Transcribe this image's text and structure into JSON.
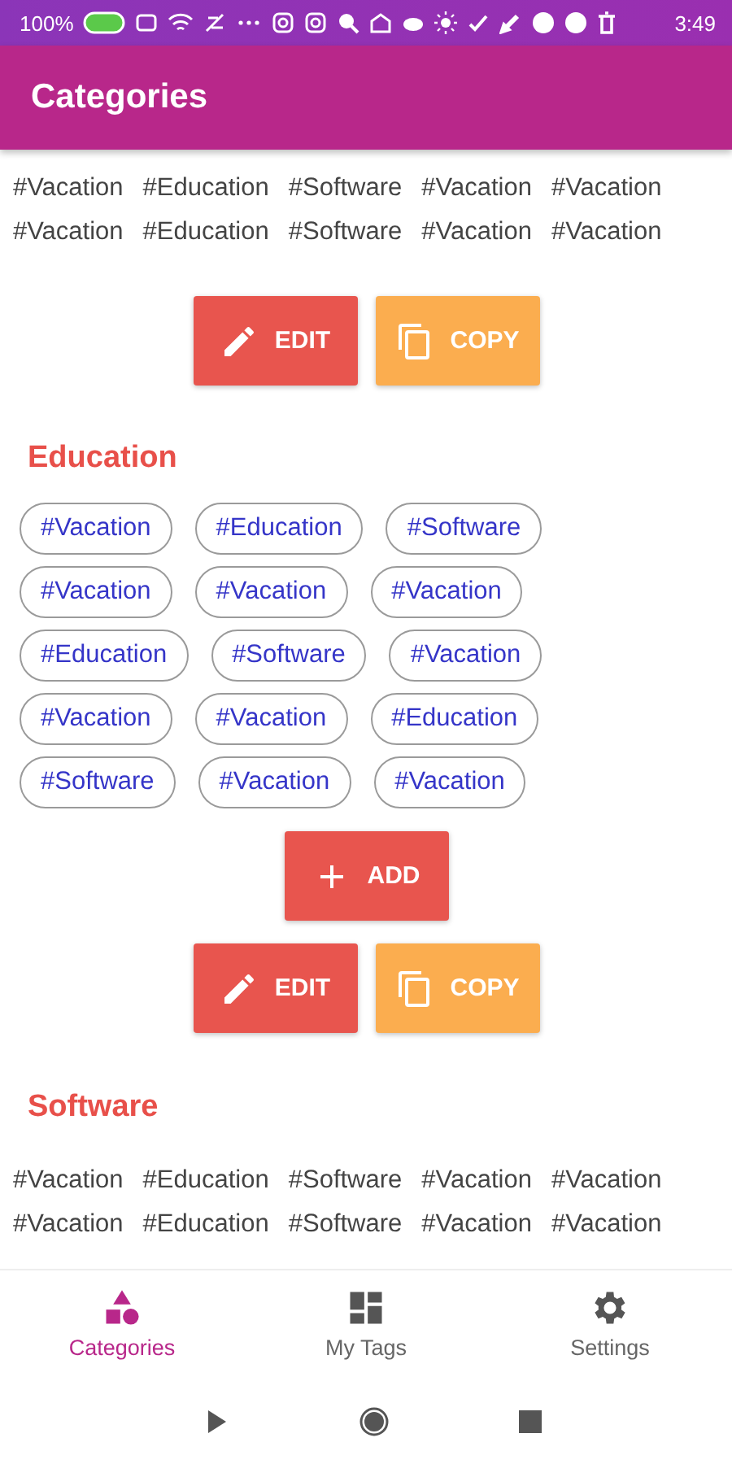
{
  "status_bar": {
    "battery": "100%",
    "time": "3:49"
  },
  "app_bar": {
    "title": "Categories"
  },
  "sections": [
    {
      "kind": "list",
      "tags": [
        "#Vacation",
        "#Education",
        "#Software",
        "#Vacation",
        "#Vacation",
        "#Vacation",
        "#Education",
        "#Software",
        "#Vacation",
        "#Vacation"
      ],
      "buttons": [
        {
          "kind": "edit",
          "label": "EDIT"
        },
        {
          "kind": "copy",
          "label": "COPY"
        }
      ]
    },
    {
      "kind": "chips",
      "title": "Education",
      "tags": [
        "#Vacation",
        "#Education",
        "#Software",
        "#Vacation",
        "#Vacation",
        "#Vacation",
        "#Education",
        "#Software",
        "#Vacation",
        "#Vacation",
        "#Vacation",
        "#Education",
        "#Software",
        "#Vacation",
        "#Vacation"
      ],
      "add": {
        "kind": "add",
        "label": "ADD"
      },
      "buttons": [
        {
          "kind": "edit",
          "label": "EDIT"
        },
        {
          "kind": "copy",
          "label": "COPY"
        }
      ]
    },
    {
      "kind": "list",
      "title": "Software",
      "tags": [
        "#Vacation",
        "#Education",
        "#Software",
        "#Vacation",
        "#Vacation",
        "#Vacation",
        "#Education",
        "#Software",
        "#Vacation",
        "#Vacation"
      ]
    }
  ],
  "bottom_nav": [
    {
      "kind": "categories",
      "label": "Categories",
      "selected": true
    },
    {
      "kind": "tags",
      "label": "My Tags",
      "selected": false
    },
    {
      "kind": "settings",
      "label": "Settings",
      "selected": false
    }
  ]
}
